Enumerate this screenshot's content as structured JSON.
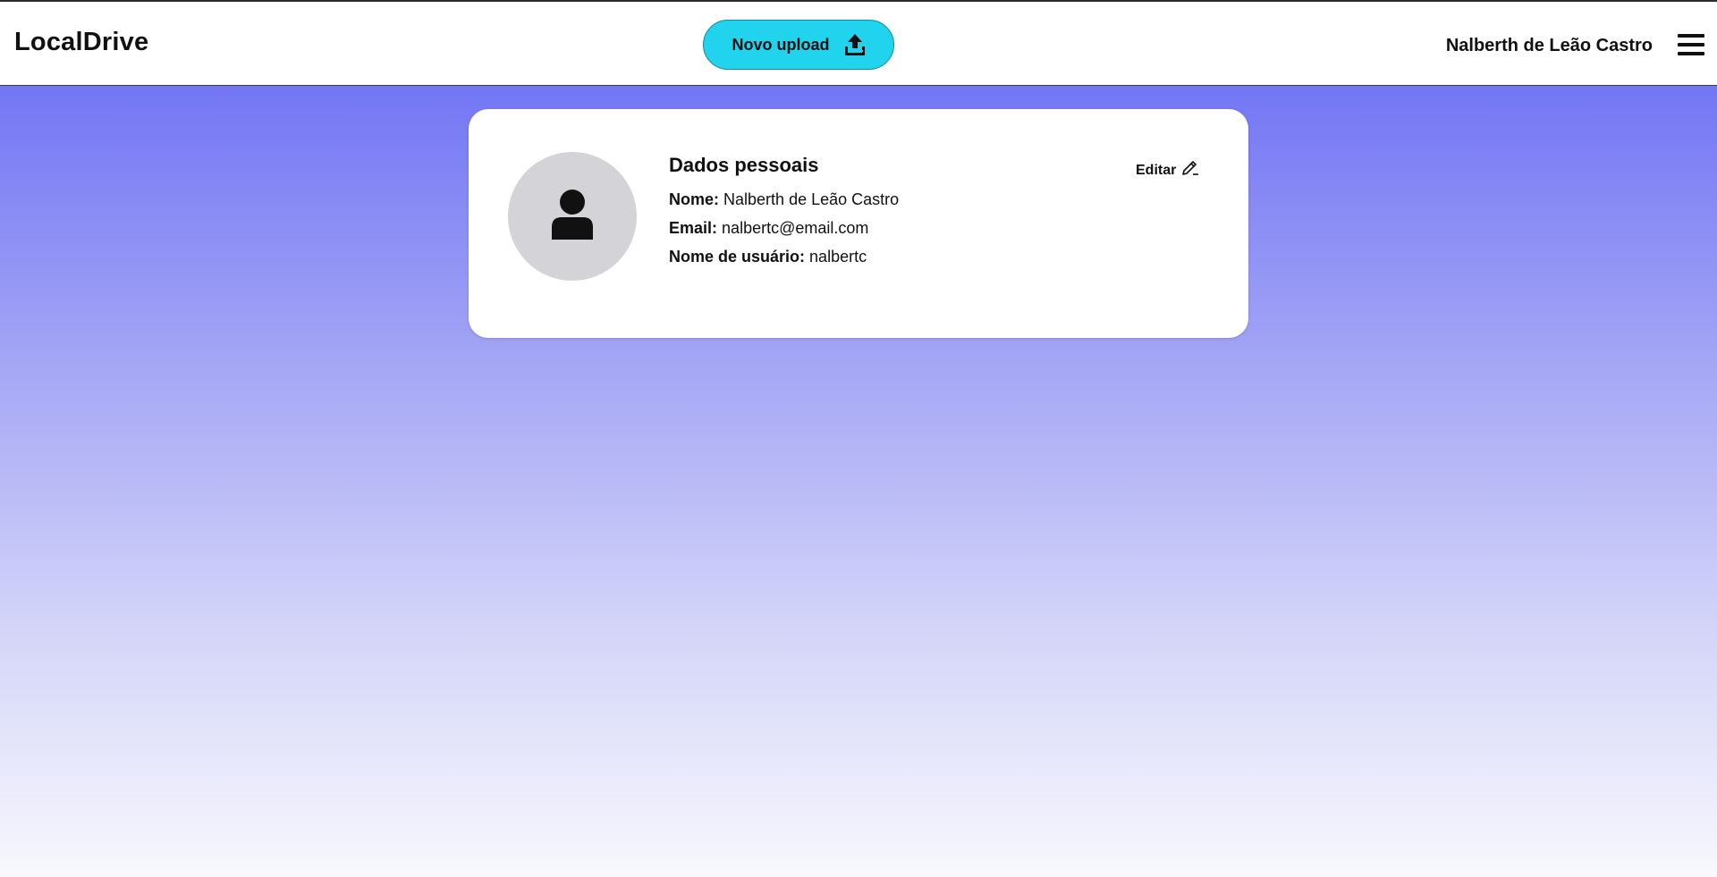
{
  "header": {
    "logo": "LocalDrive",
    "upload_label": "Novo upload",
    "upload_icon": "upload-icon",
    "user_name": "Nalberth de Leão Castro",
    "menu_icon": "hamburger-menu-icon"
  },
  "profile": {
    "title": "Dados pessoais",
    "edit_label": "Editar",
    "edit_icon": "pencil-icon",
    "avatar_icon": "user-icon",
    "fields": [
      {
        "label": "Nome:",
        "value": "Nalberth de Leão Castro"
      },
      {
        "label": "Email:",
        "value": "nalbertc@email.com"
      },
      {
        "label": "Nome de usuário:",
        "value": "nalbertc"
      }
    ]
  },
  "colors": {
    "accent": "#22d3ee",
    "background_top": "#7376f4",
    "background_bottom": "#f8f8fd",
    "avatar_bg": "#d4d4d8"
  }
}
